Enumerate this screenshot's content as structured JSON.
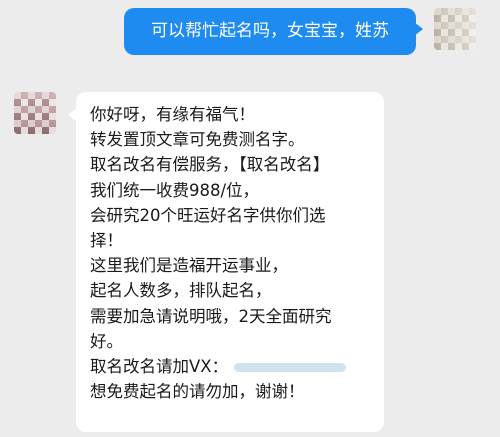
{
  "outgoing": {
    "text": "可以帮忙起名吗，女宝宝，姓苏",
    "bubble_color": "#1e8bf0"
  },
  "incoming": {
    "lines": [
      "你好呀，有缘有福气！",
      "转发置顶文章可免费测名字。",
      "取名改名有偿服务，【取名改名】",
      "我们统一收费988/位，",
      "会研究20个旺运好名字供你们选",
      "择！",
      "这里我们是造福开运事业，",
      "起名人数多，排队起名，",
      "需要加急请说明哦，2天全面研究",
      "好。",
      "取名改名请加VX：",
      "想免费起名的请勿加，谢谢！"
    ],
    "bubble_color": "#ffffff"
  },
  "background_color": "#ececec"
}
